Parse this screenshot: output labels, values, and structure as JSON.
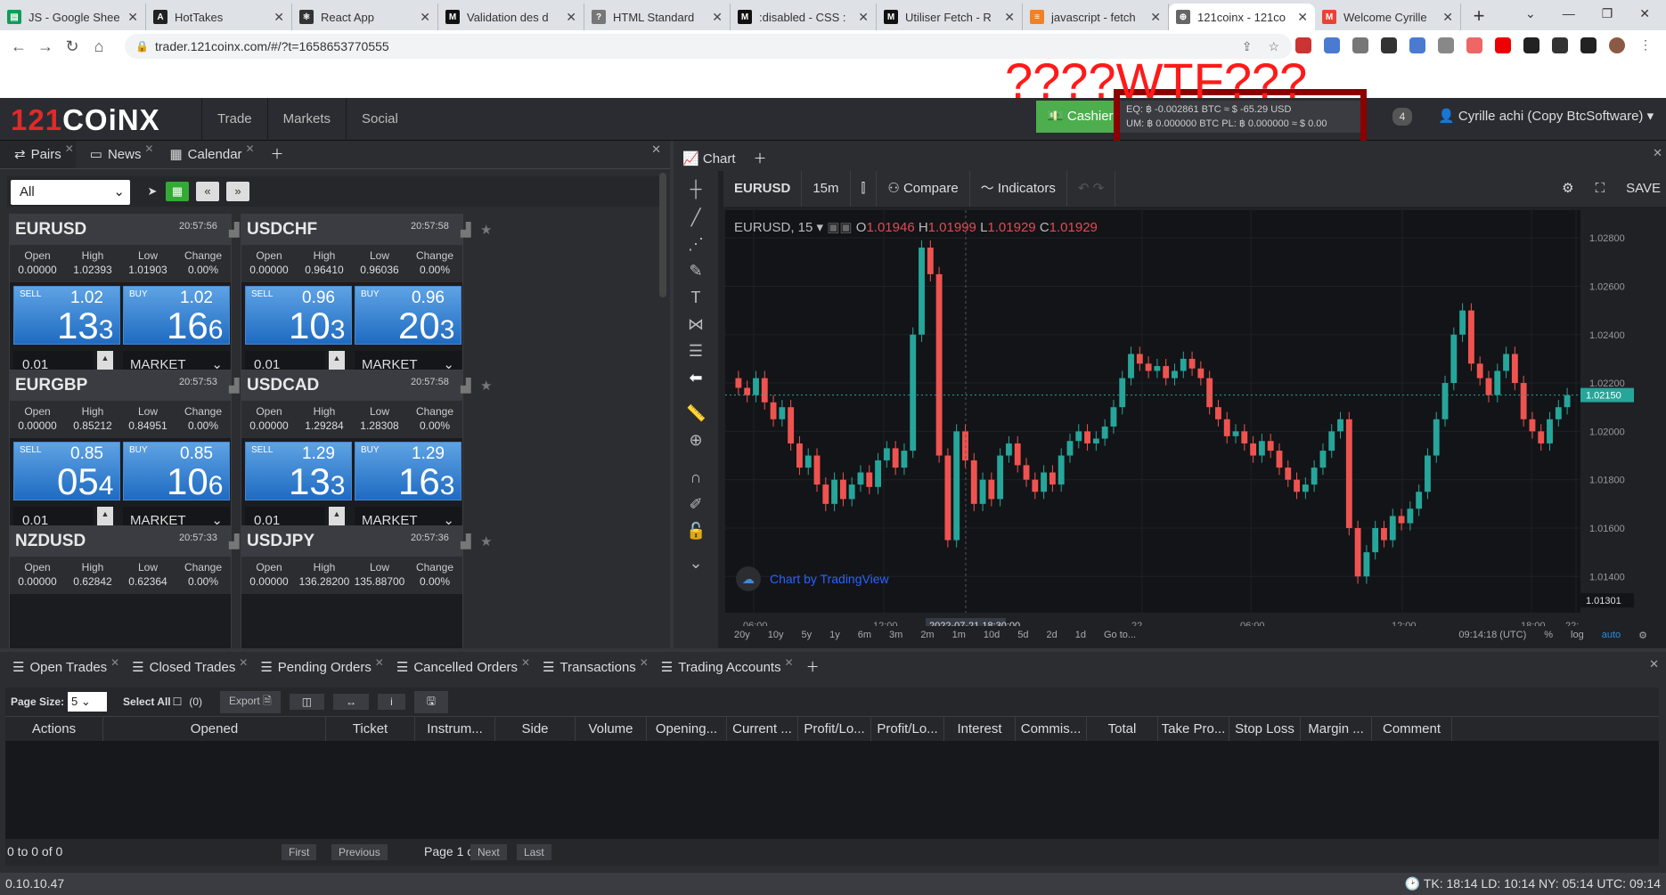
{
  "browser": {
    "tabs": [
      {
        "title": "JS - Google Shee",
        "fav": "sheets-icon",
        "color": "#0f9d58",
        "letter": "▤"
      },
      {
        "title": "HotTakes",
        "fav": "hottakes-icon",
        "color": "#222",
        "letter": "A"
      },
      {
        "title": "React App",
        "fav": "react-icon",
        "color": "#333",
        "letter": "⚛"
      },
      {
        "title": "Validation des d",
        "fav": "mdn-icon",
        "color": "#111",
        "letter": "M"
      },
      {
        "title": "HTML Standard",
        "fav": "whatwg-icon",
        "color": "#777",
        "letter": "?"
      },
      {
        "title": ":disabled - CSS :",
        "fav": "mdn-icon",
        "color": "#111",
        "letter": "M"
      },
      {
        "title": "Utiliser Fetch - R",
        "fav": "mdn-icon",
        "color": "#111",
        "letter": "M"
      },
      {
        "title": "javascript - fetch",
        "fav": "stackoverflow-icon",
        "color": "#f48024",
        "letter": "≡"
      },
      {
        "title": "121coinx - 121co",
        "fav": "globe-icon",
        "color": "#666",
        "letter": "⊕"
      },
      {
        "title": "Welcome Cyrille",
        "fav": "gmail-icon",
        "color": "#ea4335",
        "letter": "M"
      }
    ],
    "url": "trader.121coinx.com/#/?t=1658653770555"
  },
  "annotations": {
    "wtf": "????WTF???",
    "q": "????"
  },
  "header": {
    "logo_a": "121",
    "logo_b": "COiNX",
    "nav": [
      "Trade",
      "Markets",
      "Social"
    ],
    "cashier": "Cashier",
    "eq": "EQ: ฿ -0.002861 BTC ≈ $ -65.29 USD",
    "um": "UM: ฿ 0.000000 BTC PL: ฿ 0.000000 ≈ $ 0.00",
    "badge": "4",
    "user": "Cyrille achi (Copy BtcSoftware)"
  },
  "left": {
    "tabs": [
      "Pairs",
      "News",
      "Calendar"
    ],
    "filter": "All",
    "tiles": [
      {
        "sym": "EURUSD",
        "time": "20:57:56",
        "open": "0.00000",
        "high": "1.02393",
        "low": "1.01903",
        "change": "0.00%",
        "sell_top": "1.02",
        "sell_big": "13",
        "sell_sm": "3",
        "buy_top": "1.02",
        "buy_big": "16",
        "buy_sm": "6",
        "qty": "0.01",
        "order": "MARKET"
      },
      {
        "sym": "USDCHF",
        "time": "20:57:58",
        "open": "0.00000",
        "high": "0.96410",
        "low": "0.96036",
        "change": "0.00%",
        "sell_top": "0.96",
        "sell_big": "10",
        "sell_sm": "3",
        "buy_top": "0.96",
        "buy_big": "20",
        "buy_sm": "3",
        "qty": "0.01",
        "order": "MARKET"
      },
      {
        "sym": "EURGBP",
        "time": "20:57:53",
        "open": "0.00000",
        "high": "0.85212",
        "low": "0.84951",
        "change": "0.00%",
        "sell_top": "0.85",
        "sell_big": "05",
        "sell_sm": "4",
        "buy_top": "0.85",
        "buy_big": "10",
        "buy_sm": "6",
        "qty": "0.01",
        "order": "MARKET"
      },
      {
        "sym": "USDCAD",
        "time": "20:57:58",
        "open": "0.00000",
        "high": "1.29284",
        "low": "1.28308",
        "change": "0.00%",
        "sell_top": "1.29",
        "sell_big": "13",
        "sell_sm": "3",
        "buy_top": "1.29",
        "buy_big": "16",
        "buy_sm": "3",
        "qty": "0.01",
        "order": "MARKET"
      },
      {
        "sym": "NZDUSD",
        "time": "20:57:33",
        "open": "0.00000",
        "high": "0.62842",
        "low": "0.62364",
        "change": "0.00%"
      },
      {
        "sym": "USDJPY",
        "time": "20:57:36",
        "open": "0.00000",
        "high": "136.28200",
        "low": "135.88700",
        "change": "0.00%"
      }
    ],
    "labels": {
      "open": "Open",
      "high": "High",
      "low": "Low",
      "change": "Change",
      "sell": "SELL",
      "buy": "BUY"
    }
  },
  "chart": {
    "tab": "Chart",
    "symbol": "EURUSD",
    "interval": "15m",
    "compare": "Compare",
    "indicators": "Indicators",
    "save": "SAVE",
    "legend": {
      "title": "EURUSD, 15",
      "o": "1.01946",
      "h": "1.01999",
      "l": "1.01929",
      "c": "1.01929"
    },
    "yticks": [
      "1.02800",
      "1.02600",
      "1.02400",
      "1.02200",
      "1.02000",
      "1.01800",
      "1.01600",
      "1.01400"
    ],
    "last_price": "1.02150",
    "low_marker": "1.01301",
    "xticks": [
      "06:00",
      "12:00",
      "22",
      "06:00",
      "12:00",
      "18:00",
      "22:"
    ],
    "crosshair_time": "2022-07-21 18:30:00",
    "tv": "Chart by TradingView",
    "ranges": [
      "20y",
      "10y",
      "5y",
      "1y",
      "6m",
      "3m",
      "2m",
      "1m",
      "10d",
      "5d",
      "2d",
      "1d",
      "Go to..."
    ],
    "clock": "09:14:18 (UTC)",
    "scale": [
      "%",
      "log",
      "auto"
    ]
  },
  "chart_data": {
    "type": "candlestick",
    "title": "EURUSD, 15",
    "ylim": [
      1.0125,
      1.029
    ],
    "close": [
      1.0218,
      1.0215,
      1.0222,
      1.0212,
      1.0205,
      1.021,
      1.0195,
      1.0185,
      1.019,
      1.0178,
      1.017,
      1.018,
      1.0172,
      1.0178,
      1.0183,
      1.0177,
      1.0188,
      1.0193,
      1.0185,
      1.0192,
      1.024,
      1.0276,
      1.0265,
      1.019,
      1.0155,
      1.02,
      1.0188,
      1.017,
      1.018,
      1.0172,
      1.019,
      1.0195,
      1.0186,
      1.018,
      1.0175,
      1.0183,
      1.0178,
      1.019,
      1.0196,
      1.02,
      1.0195,
      1.0197,
      1.0202,
      1.021,
      1.0222,
      1.0232,
      1.0228,
      1.0225,
      1.0227,
      1.0222,
      1.0225,
      1.023,
      1.0226,
      1.0222,
      1.021,
      1.0205,
      1.0198,
      1.02,
      1.0195,
      1.019,
      1.0196,
      1.0192,
      1.0185,
      1.018,
      1.0175,
      1.0178,
      1.0185,
      1.0192,
      1.02,
      1.0205,
      1.016,
      1.014,
      1.015,
      1.016,
      1.0155,
      1.0165,
      1.0162,
      1.0168,
      1.0175,
      1.019,
      1.0205,
      1.022,
      1.024,
      1.025,
      1.0228,
      1.0222,
      1.0215,
      1.0225,
      1.0232,
      1.022,
      1.0205,
      1.02,
      1.0195,
      1.0205,
      1.021,
      1.0215
    ]
  },
  "trades": {
    "tabs": [
      "Open Trades",
      "Closed Trades",
      "Pending Orders",
      "Cancelled Orders",
      "Transactions",
      "Trading Accounts"
    ],
    "page_size_label": "Page Size:",
    "page_size": "5",
    "select_all": "Select All",
    "select_count": "(0)",
    "export": "Export",
    "columns": [
      "Actions",
      "Opened",
      "Ticket",
      "Instrum...",
      "Side",
      "Volume",
      "Opening...",
      "Current ...",
      "Profit/Lo...",
      "Profit/Lo...",
      "Interest",
      "Commis...",
      "Total",
      "Take Pro...",
      "Stop Loss",
      "Margin ...",
      "Comment"
    ],
    "count": "0 to 0 of 0",
    "pager": {
      "first": "First",
      "prev": "Previous",
      "page": "Page 1 of 0",
      "next": "Next",
      "last": "Last"
    }
  },
  "status": {
    "version": "0.10.10.47",
    "clocks": "TK: 18:14 LD: 10:14 NY: 05:14 UTC: 09:14"
  }
}
